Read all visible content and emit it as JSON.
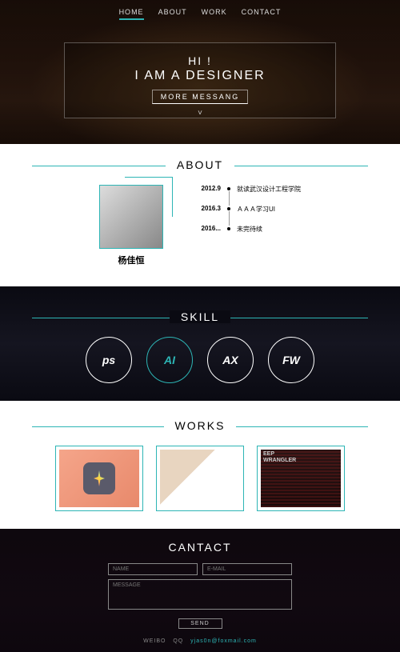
{
  "nav": {
    "items": [
      "HOME",
      "ABOUT",
      "WORK",
      "CONTACT"
    ],
    "active": 0
  },
  "hero": {
    "hi": "HI !",
    "tag": "I AM A DESIGNER",
    "more": "MORE MESSANG"
  },
  "about": {
    "title": "ABOUT",
    "name": "杨佳恒",
    "timeline": [
      {
        "date": "2012.9",
        "text": "就读武汉设计工程学院"
      },
      {
        "date": "2016.3",
        "text": "ＡＡＡ学习UI"
      },
      {
        "date": "2016...",
        "text": "未完待续"
      }
    ]
  },
  "skill": {
    "title": "SKILL",
    "items": [
      "ps",
      "AI",
      "AX",
      "FW"
    ],
    "highlight": 1
  },
  "works": {
    "title": "WORKS",
    "card3": {
      "t1": "EEP",
      "t2": "WRANGLER"
    }
  },
  "contact": {
    "title": "CANTACT",
    "name_ph": "NAME",
    "email_ph": "E-MAIL",
    "msg_ph": "MESSAGE",
    "send": "SEND"
  },
  "footer": {
    "l1": "WEIBO",
    "l2": "QQ",
    "email": "yjas0n@foxmail.com"
  }
}
